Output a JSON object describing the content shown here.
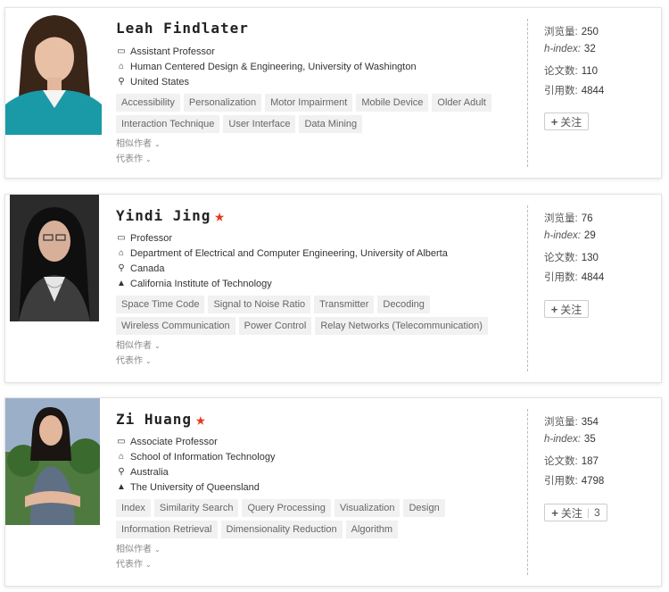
{
  "labels": {
    "views": "浏览量:",
    "hindex": "h-index:",
    "papers": "论文数:",
    "citations": "引用数:",
    "similar": "相似作者",
    "representative": "代表作",
    "follow": "关注"
  },
  "people": [
    {
      "name": "Leah Findlater",
      "title": "Assistant Professor",
      "org": "Human Centered Design & Engineering, University of Washington",
      "location": "United States",
      "tags": [
        "Accessibility",
        "Personalization",
        "Motor Impairment",
        "Mobile Device",
        "Older Adult",
        "Interaction Technique",
        "User Interface",
        "Data Mining"
      ],
      "views": "250",
      "hindex": "32",
      "papers": "110",
      "citations": "4844"
    },
    {
      "name": "Yindi Jing",
      "title": "Professor",
      "org": "Department of Electrical and Computer Engineering, University of Alberta",
      "location": "Canada",
      "education": "California Institute of Technology",
      "tags": [
        "Space Time Code",
        "Signal to Noise Ratio",
        "Transmitter",
        "Decoding",
        "Wireless Communication",
        "Power Control",
        "Relay Networks (Telecommunication)"
      ],
      "views": "76",
      "hindex": "29",
      "papers": "130",
      "citations": "4844"
    },
    {
      "name": "Zi Huang",
      "title": "Associate Professor",
      "org": "School of Information Technology",
      "location": "Australia",
      "education": "The University of Queensland",
      "tags": [
        "Index",
        "Similarity Search",
        "Query Processing",
        "Visualization",
        "Design",
        "Information Retrieval",
        "Dimensionality Reduction",
        "Algorithm"
      ],
      "views": "354",
      "hindex": "35",
      "papers": "187",
      "citations": "4798",
      "follow_count": "3"
    }
  ],
  "colors": {
    "star": "#e5391c",
    "tag_bg": "#f1f1f1"
  }
}
